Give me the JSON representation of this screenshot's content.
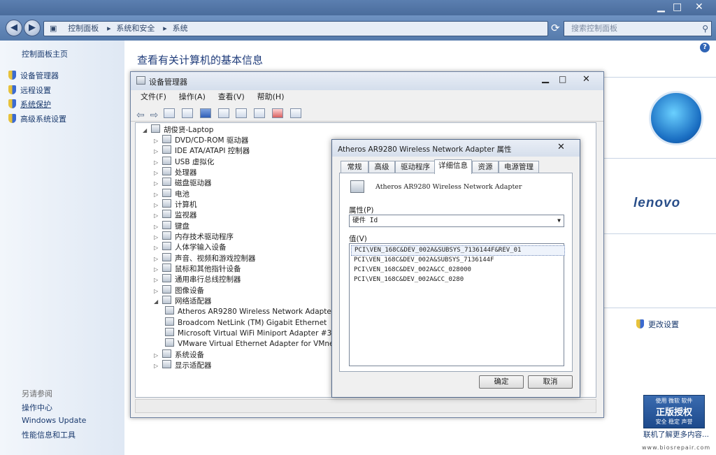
{
  "address": {
    "crumbs": [
      "控制面板",
      "系统和安全",
      "系统"
    ],
    "search_placeholder": "搜索控制面板"
  },
  "left_nav": {
    "home": "控制面板主页",
    "items": [
      "设备管理器",
      "远程设置",
      "系统保护",
      "高级系统设置"
    ],
    "see_also_heading": "另请参阅",
    "see_also": [
      "操作中心",
      "Windows Update",
      "性能信息和工具"
    ]
  },
  "main": {
    "title": "查看有关计算机的基本信息",
    "change_settings": "更改设置",
    "help": "?",
    "genuine_link": "联机了解更多内容..."
  },
  "badge": {
    "top": "使用 微软 软件",
    "main": "正版授权",
    "sub": "安全 稳定 声誉"
  },
  "watermark": "www.biosrepair.com",
  "device_manager": {
    "title": "设备管理器",
    "menu": [
      "文件(F)",
      "操作(A)",
      "查看(V)",
      "帮助(H)"
    ],
    "computer": "胡俊贤-Laptop",
    "categories": [
      "DVD/CD-ROM 驱动器",
      "IDE ATA/ATAPI 控制器",
      "USB 虚拟化",
      "处理器",
      "磁盘驱动器",
      "电池",
      "计算机",
      "监视器",
      "键盘",
      "内存技术驱动程序",
      "人体学输入设备",
      "声音、视频和游戏控制器",
      "鼠标和其他指针设备",
      "通用串行总线控制器",
      "图像设备",
      "网络适配器"
    ],
    "network_adapters": [
      "Atheros AR9280 Wireless Network Adapter",
      "Broadcom NetLink (TM) Gigabit Ethernet",
      "Microsoft Virtual WiFi Miniport Adapter #3",
      "VMware Virtual Ethernet Adapter for VMnet1"
    ],
    "categories_after": [
      "系统设备",
      "显示适配器"
    ]
  },
  "properties": {
    "title": "Atheros AR9280 Wireless Network Adapter 属性",
    "tabs": [
      "常规",
      "高级",
      "驱动程序",
      "详细信息",
      "资源",
      "电源管理"
    ],
    "device_name": "Atheros AR9280 Wireless Network Adapter",
    "property_label": "属性(P)",
    "property_value": "硬件 Id",
    "value_label": "值(V)",
    "values": [
      "PCI\\VEN_168C&DEV_002A&SUBSYS_7136144F&REV_01",
      "PCI\\VEN_168C&DEV_002A&SUBSYS_7136144F",
      "PCI\\VEN_168C&DEV_002A&CC_028000",
      "PCI\\VEN_168C&DEV_002A&CC_0280"
    ],
    "ok": "确定",
    "cancel": "取消"
  }
}
